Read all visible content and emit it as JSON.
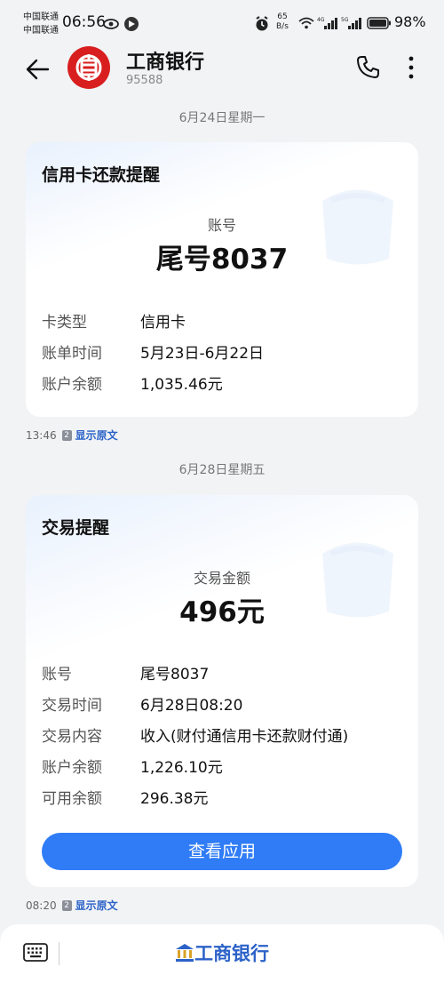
{
  "status_bar": {
    "carrier_1": "中国联通",
    "carrier_2": "中国联通",
    "time": "06:56",
    "net_speed_value": "65",
    "net_speed_unit": "B/s",
    "battery": "98%"
  },
  "header": {
    "title": "工商银行",
    "number": "95588"
  },
  "messages": [
    {
      "date": "6月24日星期一",
      "card_title": "信用卡还款提醒",
      "center_label": "账号",
      "center_value": "尾号8037",
      "rows": [
        {
          "label": "卡类型",
          "value": "信用卡"
        },
        {
          "label": "账单时间",
          "value": "5月23日-6月22日"
        },
        {
          "label": "账户余额",
          "value": "1,035.46元"
        }
      ],
      "time": "13:46",
      "sim": "2",
      "show_original": "显示原文"
    },
    {
      "date": "6月28日星期五",
      "card_title": "交易提醒",
      "center_label": "交易金额",
      "center_value": "496元",
      "rows": [
        {
          "label": "账号",
          "value": "尾号8037"
        },
        {
          "label": "交易时间",
          "value": "6月28日08:20"
        },
        {
          "label": "交易内容",
          "value": "收入(财付通信用卡还款财付通)"
        },
        {
          "label": "账户余额",
          "value": "1,226.10元"
        },
        {
          "label": "可用余额",
          "value": "296.38元"
        }
      ],
      "button": "查看应用",
      "time": "08:20",
      "sim": "2",
      "show_original": "显示原文"
    }
  ],
  "bottom_bar": {
    "menu_label": "工商银行",
    "keyboard_icon": "keyboard-icon",
    "bank_icon": "bank-building-icon"
  },
  "colors": {
    "brand_red": "#d81e1e",
    "accent_blue": "#2f7cf6",
    "link_blue": "#2b62c8"
  }
}
